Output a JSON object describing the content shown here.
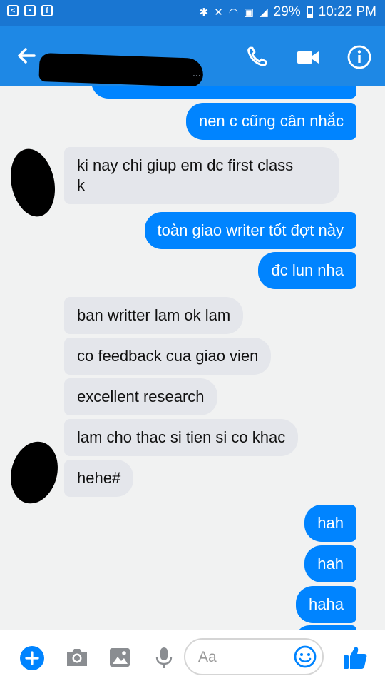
{
  "status_bar": {
    "left_icons": [
      "share-icon",
      "image-icon",
      "facebook-icon"
    ],
    "facebook_letter": "f",
    "battery": "29%",
    "time": "10:22 PM",
    "right_icons": [
      "bluetooth-icon",
      "mute-icon",
      "wifi-icon",
      "nfc-icon",
      "signal-icon",
      "battery-icon"
    ]
  },
  "header": {
    "contact_name": "",
    "subtitle": "...",
    "icons": [
      "back-arrow-icon",
      "phone-icon",
      "video-camera-icon",
      "info-icon"
    ]
  },
  "messages": [
    {
      "side": "out",
      "text": ""
    },
    {
      "side": "out",
      "text": "nen c cũng cân nhắc"
    },
    {
      "side": "in",
      "text": "ki nay chi giup em dc first class\nk"
    },
    {
      "side": "out",
      "text": "toàn giao writer tốt đợt này"
    },
    {
      "side": "out",
      "text": "đc lun nha"
    },
    {
      "side": "in",
      "text": "ban writter lam ok lam"
    },
    {
      "side": "in",
      "text": "co feedback cua giao vien"
    },
    {
      "side": "in",
      "text": "excellent research"
    },
    {
      "side": "in",
      "text": "lam cho thac si tien si co khac"
    },
    {
      "side": "in",
      "text": "hehe#"
    },
    {
      "side": "out",
      "text": "hah"
    },
    {
      "side": "out",
      "text": "hah"
    },
    {
      "side": "out",
      "text": "haha"
    }
  ],
  "composer": {
    "placeholder": "Aa",
    "icons": [
      "add-icon",
      "camera-icon",
      "gallery-icon",
      "microphone-icon",
      "emoji-icon",
      "thumbs-up-icon"
    ]
  },
  "colors": {
    "status_bar": "#1976d2",
    "header": "#1e88e5",
    "outgoing_bubble": "#0084ff",
    "incoming_bubble": "#e4e6eb",
    "chat_background": "#f1f2f2",
    "accent": "#0084ff"
  }
}
